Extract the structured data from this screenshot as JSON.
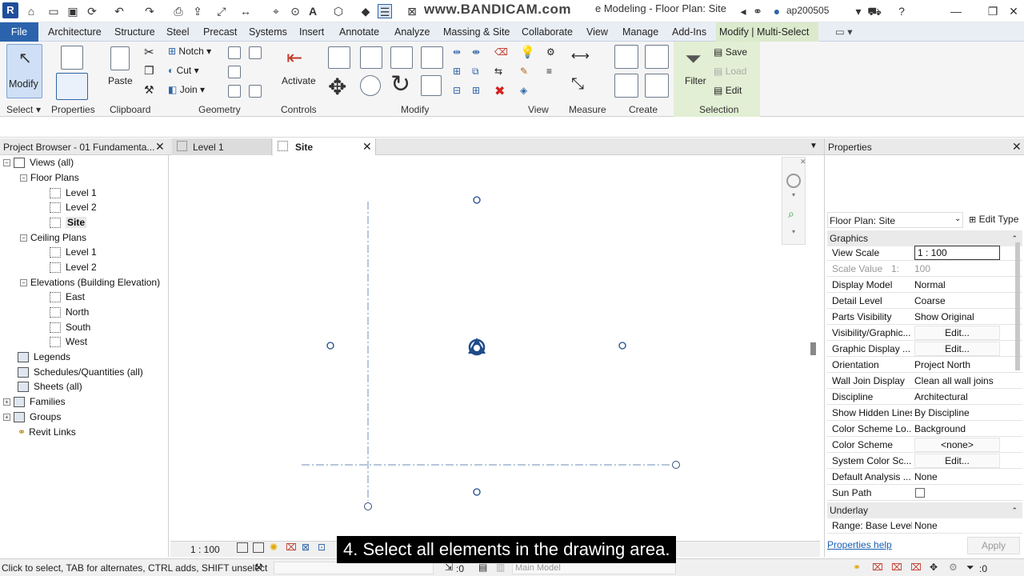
{
  "titlebar": {
    "logo": "R",
    "watermark": "www.BANDICAM.com",
    "title": "e Modeling - Floor Plan: Site",
    "user": "ap200505"
  },
  "menu": {
    "tabs": [
      "File",
      "Architecture",
      "Structure",
      "Steel",
      "Precast",
      "Systems",
      "Insert",
      "Annotate",
      "Analyze",
      "Massing & Site",
      "Collaborate",
      "View",
      "Manage",
      "Add-Ins",
      "Modify | Multi-Select"
    ]
  },
  "ribbon": {
    "modify_label": "Modify",
    "paste_label": "Paste",
    "notch_label": "Notch",
    "cut_label": "Cut",
    "join_label": "Join",
    "activate_label": "Activate",
    "filter_label": "Filter",
    "save_label": "Save",
    "load_label": "Load",
    "edit_label": "Edit",
    "panels": {
      "select": "Select",
      "properties": "Properties",
      "clipboard": "Clipboard",
      "geometry": "Geometry",
      "controls": "Controls",
      "modify": "Modify",
      "view": "View",
      "measure": "Measure",
      "create": "Create",
      "selection": "Selection"
    }
  },
  "project_browser": {
    "title": "Project Browser - 01 Fundamenta...",
    "items": {
      "views": "Views (all)",
      "floor_plans": "Floor Plans",
      "fp_level1": "Level 1",
      "fp_level2": "Level 2",
      "fp_site": "Site",
      "ceiling_plans": "Ceiling Plans",
      "cp_level1": "Level 1",
      "cp_level2": "Level 2",
      "elevations": "Elevations (Building Elevation)",
      "east": "East",
      "north": "North",
      "south": "South",
      "west": "West",
      "legends": "Legends",
      "schedules": "Schedules/Quantities (all)",
      "sheets": "Sheets (all)",
      "families": "Families",
      "groups": "Groups",
      "revit_links": "Revit Links"
    }
  },
  "view_tabs": {
    "tab1": "Level 1",
    "tab2": "Site"
  },
  "properties": {
    "title": "Properties",
    "type_selector": "Floor Plan: Site",
    "edit_type": "Edit Type",
    "sections": {
      "graphics": "Graphics",
      "underlay": "Underlay"
    },
    "rows": {
      "view_scale_name": "View Scale",
      "view_scale_value": "1 : 100",
      "scale_value_name": "Scale Value",
      "scale_value_prefix": "1:",
      "scale_value_value": "100",
      "display_model_name": "Display Model",
      "display_model_value": "Normal",
      "detail_level_name": "Detail Level",
      "detail_level_value": "Coarse",
      "parts_visibility_name": "Parts Visibility",
      "parts_visibility_value": "Show Original",
      "vis_graphics_name": "Visibility/Graphic...",
      "vis_graphics_value": "Edit...",
      "graphic_display_name": "Graphic Display ...",
      "graphic_display_value": "Edit...",
      "orientation_name": "Orientation",
      "orientation_value": "Project North",
      "wall_join_name": "Wall Join Display",
      "wall_join_value": "Clean all wall joins",
      "discipline_name": "Discipline",
      "discipline_value": "Architectural",
      "hidden_lines_name": "Show Hidden Lines",
      "hidden_lines_value": "By Discipline",
      "color_scheme_loc_name": "Color Scheme Lo...",
      "color_scheme_loc_value": "Background",
      "color_scheme_name": "Color Scheme",
      "color_scheme_value": "<none>",
      "system_color_name": "System Color Sc...",
      "system_color_value": "Edit...",
      "default_analysis_name": "Default Analysis ...",
      "default_analysis_value": "None",
      "sun_path_name": "Sun Path",
      "range_base_name": "Range: Base Level",
      "range_base_value": "None"
    },
    "help": "Properties help",
    "apply": "Apply"
  },
  "view_control": {
    "scale": "1 : 100"
  },
  "status": {
    "hint": "Click to select, TAB for alternates, CTRL adds, SHIFT unselect",
    "count": ":0",
    "model": "Main Model"
  },
  "subtitle": "4. Select all elements in the drawing area."
}
